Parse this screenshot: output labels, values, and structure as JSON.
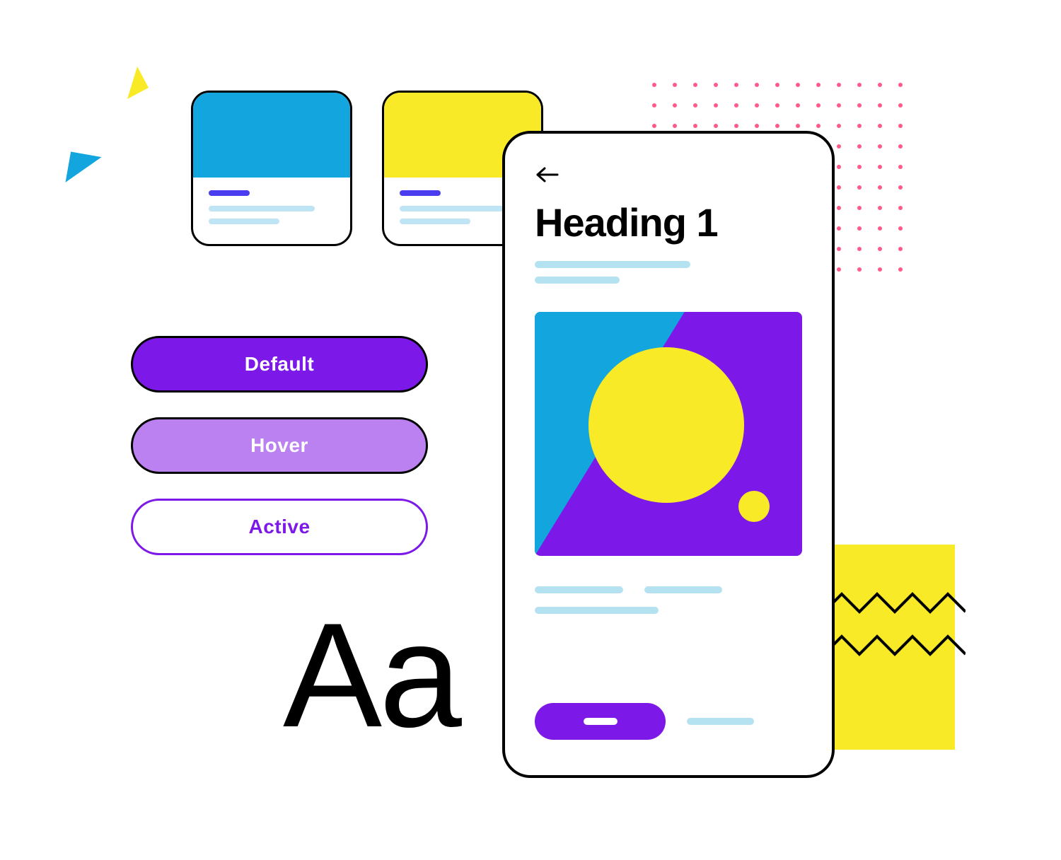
{
  "swatches": {
    "blue": {
      "color": "#12a5de"
    },
    "yellow": {
      "color": "#f9ea28"
    }
  },
  "buttons": {
    "default": {
      "label": "Default"
    },
    "hover": {
      "label": "Hover"
    },
    "active": {
      "label": "Active"
    }
  },
  "typography": {
    "sample": "Aa"
  },
  "phone": {
    "heading": "Heading 1"
  },
  "palette": {
    "primary": "#7c19e8",
    "primary_light": "#bb81f0",
    "accent_blue": "#12a5de",
    "accent_yellow": "#f9ea28",
    "outline": "#000000",
    "text_placeholder": "#b5e2f1",
    "dot": "#ff5a8a"
  }
}
